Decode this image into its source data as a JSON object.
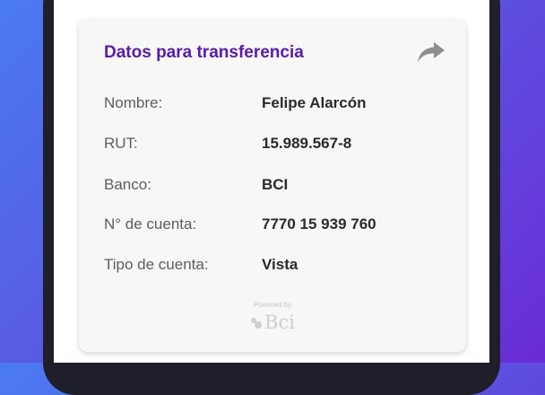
{
  "card": {
    "title": "Datos para transferencia",
    "share_icon": "share-arrow-icon",
    "fields": [
      {
        "label": "Nombre:",
        "value": "Felipe Alarcón"
      },
      {
        "label": "RUT:",
        "value": "15.989.567-8"
      },
      {
        "label": "Banco:",
        "value": "BCI"
      },
      {
        "label": "N° de cuenta:",
        "value": "7770 15 939 760"
      },
      {
        "label": "Tipo de cuenta:",
        "value": "Vista"
      }
    ],
    "powered_by": "Powered by",
    "brand_name": "Bci"
  },
  "colors": {
    "title": "#5a1aa6",
    "background_start": "#4a7bf2",
    "background_end": "#6a2bd6",
    "card": "#f7f7f7"
  }
}
